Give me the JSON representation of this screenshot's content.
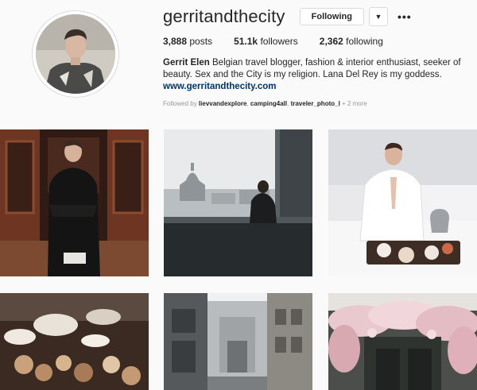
{
  "profile": {
    "username": "gerritandthecity",
    "follow_button_label": "Following",
    "dropdown_glyph": "▼",
    "more_glyph": "•••",
    "stats": {
      "posts_count": "3,888",
      "posts_label": "posts",
      "followers_count": "51.1k",
      "followers_label": "followers",
      "following_count": "2,362",
      "following_label": "following"
    },
    "bio_name": "Gerrit Elen",
    "bio_text": "Belgian travel blogger, fashion & interior enthusiast, seeker of beauty. Sex and the City is my religion. Lana Del Rey is my goddess.",
    "website": "www.gerritandthecity.com",
    "followed_by": {
      "prefix": "Followed by",
      "users": [
        "lievvandexplore",
        "camping4all",
        "traveler_photo_l"
      ],
      "suffix": "+ 2 more"
    }
  },
  "grid": {
    "posts": [
      {
        "description": "Man in dark jacket in wood paneled room"
      },
      {
        "description": "Person looking out window at city dome"
      },
      {
        "description": "Man in white robe with breakfast tray in bed"
      },
      {
        "description": "Pastries and cakes on display"
      },
      {
        "description": "Narrow city street with buildings"
      },
      {
        "description": "Cafe facade covered with flowers"
      }
    ]
  },
  "colors": {
    "background": "#fafafa",
    "link": "#003569",
    "muted": "#999999",
    "border": "#dbdbdb"
  }
}
